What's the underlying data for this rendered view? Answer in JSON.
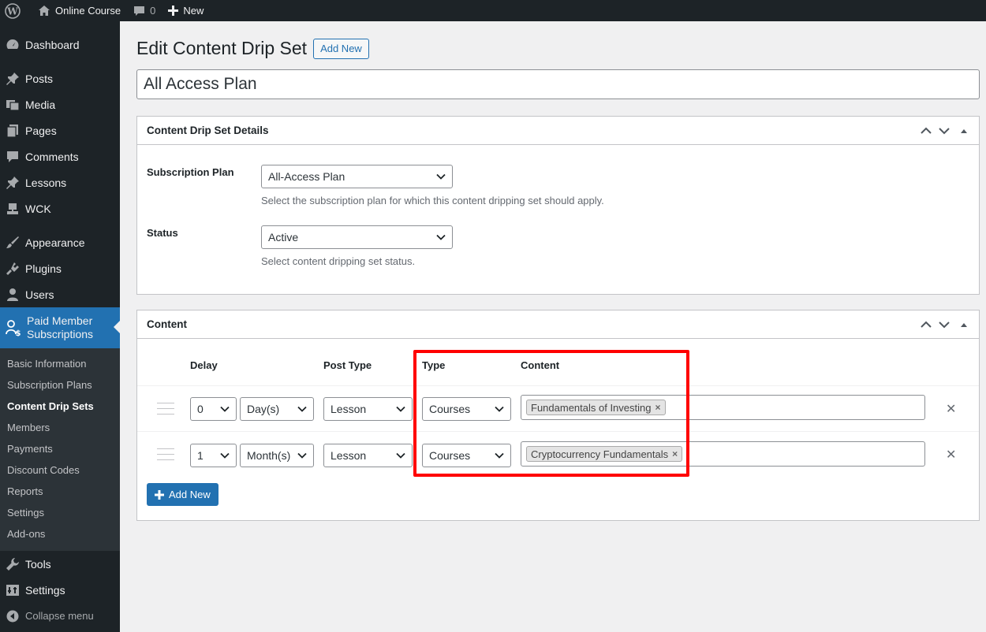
{
  "adminbar": {
    "site_name": "Online Course",
    "comments_count": "0",
    "new_label": "New"
  },
  "sidebar": {
    "items": [
      {
        "label": "Dashboard",
        "icon": "dashboard-icon"
      },
      {
        "label": "Posts",
        "icon": "pin-icon"
      },
      {
        "label": "Media",
        "icon": "media-icon"
      },
      {
        "label": "Pages",
        "icon": "pages-icon"
      },
      {
        "label": "Comments",
        "icon": "comment-icon"
      },
      {
        "label": "Lessons",
        "icon": "pin-icon"
      },
      {
        "label": "WCK",
        "icon": "wck-icon"
      },
      {
        "label": "Appearance",
        "icon": "brush-icon"
      },
      {
        "label": "Plugins",
        "icon": "plugin-icon"
      },
      {
        "label": "Users",
        "icon": "users-icon"
      },
      {
        "label": "Paid Member Subscriptions",
        "icon": "pms-icon"
      }
    ],
    "submenu": [
      "Basic Information",
      "Subscription Plans",
      "Content Drip Sets",
      "Members",
      "Payments",
      "Discount Codes",
      "Reports",
      "Settings",
      "Add-ons"
    ],
    "bottom": [
      {
        "label": "Tools",
        "icon": "wrench-icon"
      },
      {
        "label": "Settings",
        "icon": "settings-icon"
      },
      {
        "label": "Collapse menu",
        "icon": "collapse-icon"
      }
    ]
  },
  "page": {
    "title": "Edit Content Drip Set",
    "add_new": "Add New",
    "set_title": "All Access Plan"
  },
  "details": {
    "heading": "Content Drip Set Details",
    "plan_label": "Subscription Plan",
    "plan_value": "All-Access Plan",
    "plan_desc": "Select the subscription plan for which this content dripping set should apply.",
    "status_label": "Status",
    "status_value": "Active",
    "status_desc": "Select content dripping set status."
  },
  "content": {
    "heading": "Content",
    "columns": {
      "delay": "Delay",
      "post_type": "Post Type",
      "type": "Type",
      "content": "Content"
    },
    "rows": [
      {
        "delay": "0",
        "unit": "Day(s)",
        "post_type": "Lesson",
        "type": "Courses",
        "item": "Fundamentals of Investing"
      },
      {
        "delay": "1",
        "unit": "Month(s)",
        "post_type": "Lesson",
        "type": "Courses",
        "item": "Cryptocurrency Fundamentals"
      }
    ],
    "add_new": "Add New",
    "tag_remove": "×",
    "row_remove": "✕"
  },
  "colors": {
    "accent": "#2271b1",
    "highlight": "#ff0000",
    "sidebar_bg": "#1d2327"
  }
}
